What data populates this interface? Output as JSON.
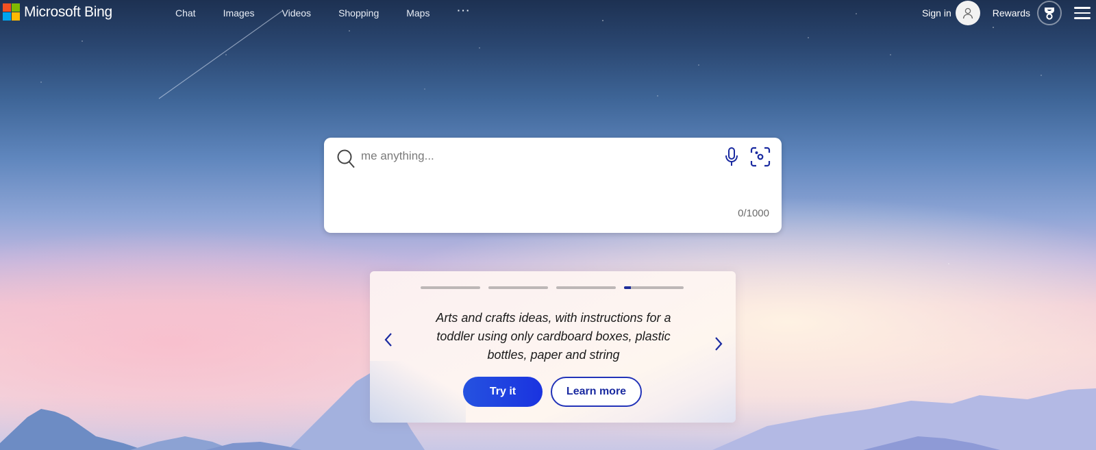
{
  "header": {
    "brand": "Microsoft Bing",
    "logo_colors": [
      "#f25022",
      "#7fba00",
      "#00a4ef",
      "#ffb900"
    ],
    "nav": [
      {
        "label": "Chat"
      },
      {
        "label": "Images"
      },
      {
        "label": "Videos"
      },
      {
        "label": "Shopping"
      },
      {
        "label": "Maps"
      },
      {
        "label": "···"
      }
    ],
    "sign_in": "Sign in",
    "rewards": "Rewards",
    "icons": {
      "avatar": "person-icon",
      "rewards": "trophy-icon",
      "menu": "hamburger-icon"
    }
  },
  "search": {
    "value": "",
    "placeholder": "me anything...",
    "char_count": "0/1000",
    "icons": {
      "search": "search-icon",
      "mic": "microphone-icon",
      "visual": "visual-search-icon"
    },
    "accent": "#1a2aa0"
  },
  "carousel": {
    "total_slides": 4,
    "active_index": 3,
    "active_progress": 0.12,
    "prompt": "Arts and crafts ideas, with instructions for a toddler using only cardboard boxes, plastic bottles, paper and string",
    "try_label": "Try it",
    "learn_label": "Learn more",
    "prev_icon": "chevron-left-icon",
    "next_icon": "chevron-right-icon",
    "primary_color": "#1f44e0"
  }
}
